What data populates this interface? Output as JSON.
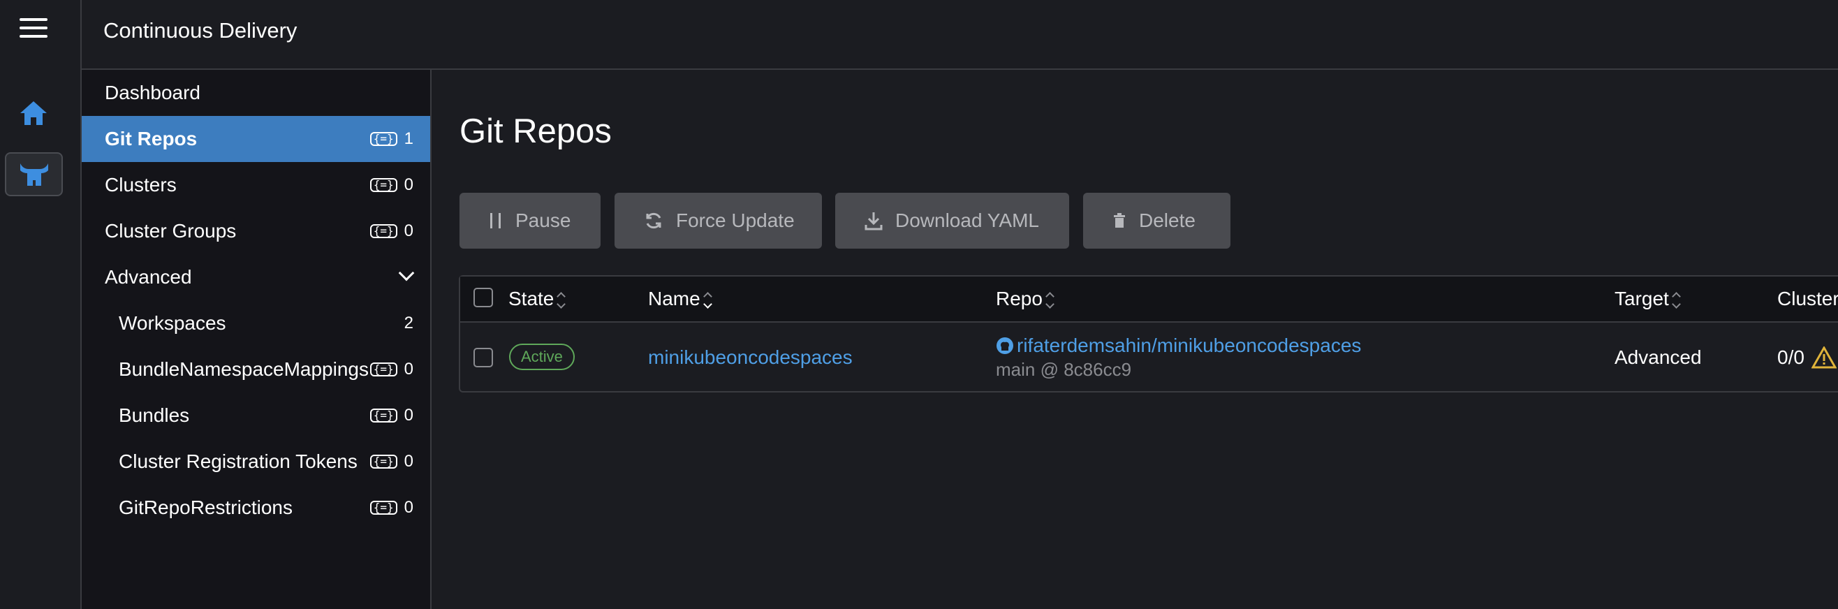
{
  "header": {
    "title": "Continuous Delivery"
  },
  "sidebar": {
    "items": [
      {
        "label": "Dashboard",
        "count": ""
      },
      {
        "label": "Git Repos",
        "count": "1"
      },
      {
        "label": "Clusters",
        "count": "0"
      },
      {
        "label": "Cluster Groups",
        "count": "0"
      },
      {
        "label": "Advanced",
        "count": ""
      },
      {
        "label": "Workspaces",
        "count": "2"
      },
      {
        "label": "BundleNamespaceMappings",
        "count": "0"
      },
      {
        "label": "Bundles",
        "count": "0"
      },
      {
        "label": "Cluster Registration Tokens",
        "count": "0"
      },
      {
        "label": "GitRepoRestrictions",
        "count": "0"
      }
    ],
    "resource_icon": "{=}"
  },
  "main": {
    "title": "Git Repos",
    "buttons": {
      "pause": "Pause",
      "force_update": "Force Update",
      "download_yaml": "Download YAML",
      "delete": "Delete"
    },
    "table": {
      "columns": {
        "state": "State",
        "name": "Name",
        "repo": "Repo",
        "target": "Target",
        "clusters": "Clusters"
      },
      "rows": [
        {
          "state": "Active",
          "name": "minikubeoncodespaces",
          "repo": "rifaterdemsahin/minikubeoncodespaces",
          "branch": "main @ 8c86cc9",
          "target": "Advanced",
          "clusters": "0/0"
        }
      ]
    }
  },
  "colors": {
    "accent": "#3d7dbf",
    "link": "#4f9fe6",
    "active_badge": "#5fa85a",
    "warning": "#e0b43a"
  },
  "icons": {
    "menu": "hamburger-icon",
    "home": "home-icon",
    "fleet": "fleet-icon",
    "pause": "pause-icon",
    "refresh": "refresh-icon",
    "download": "download-icon",
    "delete": "trash-icon",
    "github": "github-icon",
    "warning": "warning-icon"
  }
}
